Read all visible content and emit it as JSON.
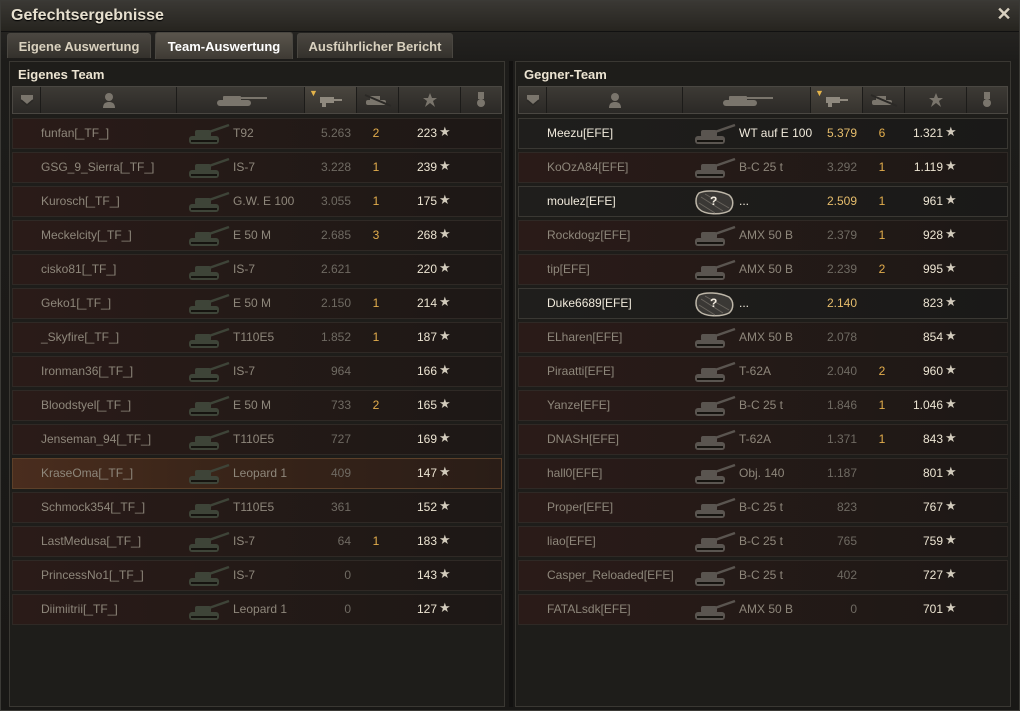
{
  "window": {
    "title": "Gefechtsergebnisse"
  },
  "tabs": [
    {
      "label": "Eigene Auswertung"
    },
    {
      "label": "Team-Auswertung"
    },
    {
      "label": "Ausführlicher Bericht"
    }
  ],
  "close_glyph": "✕",
  "star_glyph": "★",
  "unknown_glyph": "?",
  "colors": {
    "accent": "#e2ad4c",
    "enemy_icon": "#5a5550",
    "own_icon": "#3e4438"
  },
  "own_team": {
    "title": "Eigenes Team",
    "rows": [
      {
        "name": "funfan[_TF_]",
        "tank": "T92",
        "damage": "5.263",
        "kills": "2",
        "xp": "223"
      },
      {
        "name": "GSG_9_Sierra[_TF_]",
        "tank": "IS-7",
        "damage": "3.228",
        "kills": "1",
        "xp": "239"
      },
      {
        "name": "Kurosch[_TF_]",
        "tank": "G.W. E 100",
        "damage": "3.055",
        "kills": "1",
        "xp": "175"
      },
      {
        "name": "Meckelcity[_TF_]",
        "tank": "E 50 M",
        "damage": "2.685",
        "kills": "3",
        "xp": "268"
      },
      {
        "name": "cisko81[_TF_]",
        "tank": "IS-7",
        "damage": "2.621",
        "kills": "",
        "xp": "220"
      },
      {
        "name": "Geko1[_TF_]",
        "tank": "E 50 M",
        "damage": "2.150",
        "kills": "1",
        "xp": "214"
      },
      {
        "name": "_Skyfire[_TF_]",
        "tank": "T110E5",
        "damage": "1.852",
        "kills": "1",
        "xp": "187"
      },
      {
        "name": "Ironman36[_TF_]",
        "tank": "IS-7",
        "damage": "964",
        "kills": "",
        "xp": "166"
      },
      {
        "name": "Bloodstyel[_TF_]",
        "tank": "E 50 M",
        "damage": "733",
        "kills": "2",
        "xp": "165"
      },
      {
        "name": "Jenseman_94[_TF_]",
        "tank": "T110E5",
        "damage": "727",
        "kills": "",
        "xp": "169"
      },
      {
        "name": "KraseOma[_TF_]",
        "tank": "Leopard 1",
        "damage": "409",
        "kills": "",
        "xp": "147"
      },
      {
        "name": "Schmock354[_TF_]",
        "tank": "T110E5",
        "damage": "361",
        "kills": "",
        "xp": "152"
      },
      {
        "name": "LastMedusa[_TF_]",
        "tank": "IS-7",
        "damage": "64",
        "kills": "1",
        "xp": "183"
      },
      {
        "name": "PrincessNo1[_TF_]",
        "tank": "IS-7",
        "damage": "0",
        "kills": "",
        "xp": "143"
      },
      {
        "name": "Diimiitrii[_TF_]",
        "tank": "Leopard 1",
        "damage": "0",
        "kills": "",
        "xp": "127"
      }
    ]
  },
  "enemy_team": {
    "title": "Gegner-Team",
    "rows": [
      {
        "name": "Meezu[EFE]",
        "tank": "WT auf E 100",
        "damage": "5.379",
        "kills": "6",
        "xp": "1.321"
      },
      {
        "name": "KoOzA84[EFE]",
        "tank": "B-C 25 t",
        "damage": "3.292",
        "kills": "1",
        "xp": "1.119"
      },
      {
        "name": "moulez[EFE]",
        "tank": "...",
        "damage": "2.509",
        "kills": "1",
        "xp": "961"
      },
      {
        "name": "Rockdogz[EFE]",
        "tank": "AMX 50 B",
        "damage": "2.379",
        "kills": "1",
        "xp": "928"
      },
      {
        "name": "tip[EFE]",
        "tank": "AMX 50 B",
        "damage": "2.239",
        "kills": "2",
        "xp": "995"
      },
      {
        "name": "Duke6689[EFE]",
        "tank": "...",
        "damage": "2.140",
        "kills": "",
        "xp": "823"
      },
      {
        "name": "ELharen[EFE]",
        "tank": "AMX 50 B",
        "damage": "2.078",
        "kills": "",
        "xp": "854"
      },
      {
        "name": "Piraatti[EFE]",
        "tank": "T-62A",
        "damage": "2.040",
        "kills": "2",
        "xp": "960"
      },
      {
        "name": "Yanze[EFE]",
        "tank": "B-C 25 t",
        "damage": "1.846",
        "kills": "1",
        "xp": "1.046"
      },
      {
        "name": "DNASH[EFE]",
        "tank": "T-62A",
        "damage": "1.371",
        "kills": "1",
        "xp": "843"
      },
      {
        "name": "hall0[EFE]",
        "tank": "Obj. 140",
        "damage": "1.187",
        "kills": "",
        "xp": "801"
      },
      {
        "name": "Proper[EFE]",
        "tank": "B-C 25 t",
        "damage": "823",
        "kills": "",
        "xp": "767"
      },
      {
        "name": "liao[EFE]",
        "tank": "B-C 25 t",
        "damage": "765",
        "kills": "",
        "xp": "759"
      },
      {
        "name": "Casper_Reloaded[EFE]",
        "tank": "B-C 25 t",
        "damage": "402",
        "kills": "",
        "xp": "727"
      },
      {
        "name": "FATALsdk[EFE]",
        "tank": "AMX 50 B",
        "damage": "0",
        "kills": "",
        "xp": "701"
      }
    ]
  }
}
